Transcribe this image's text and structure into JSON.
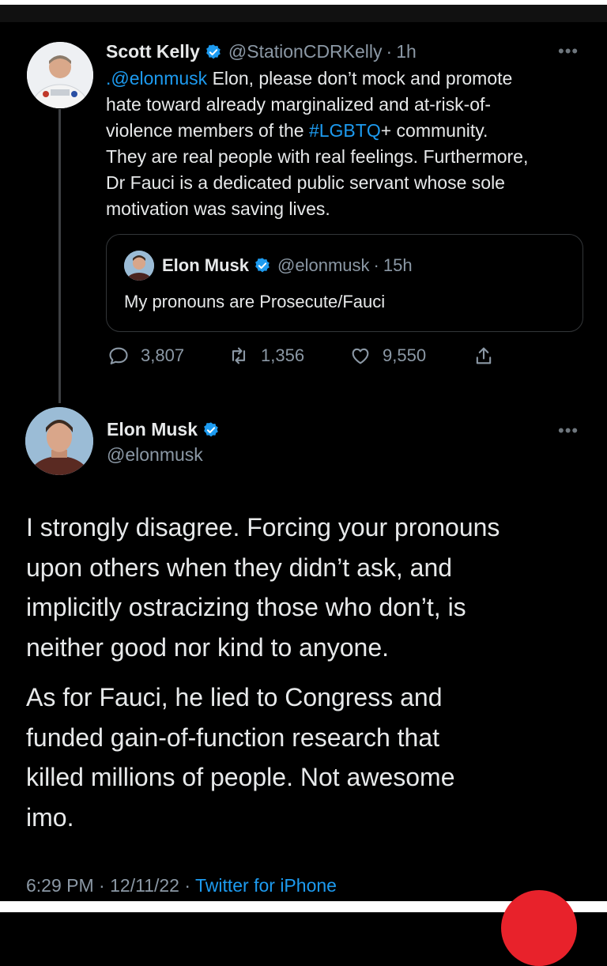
{
  "parent_tweet": {
    "author_name": "Scott Kelly",
    "handle": "@StationCDRKelly",
    "separator": "·",
    "time": "1h",
    "more": "•••",
    "text_lines": [
      {
        "mention": ".@elonmusk",
        "rest": " Elon, please don’t mock and promote"
      },
      {
        "plain": "hate toward already marginalized and at-risk-of-"
      },
      {
        "before": "violence members of the ",
        "hashtag": "#LGBTQ",
        "after": "+ community."
      },
      {
        "plain": "They are real people with real feelings. Furthermore,"
      },
      {
        "plain": "Dr Fauci is a dedicated public servant whose sole"
      },
      {
        "plain": "motivation was saving lives."
      }
    ],
    "quote": {
      "author_name": "Elon Musk",
      "handle": "@elonmusk",
      "separator": "·",
      "time": "15h",
      "text": "My pronouns are Prosecute/Fauci"
    },
    "actions": {
      "replies": "3,807",
      "retweets": "1,356",
      "likes": "9,550"
    }
  },
  "main_tweet": {
    "author_name": "Elon Musk",
    "handle": "@elonmusk",
    "more": "•••",
    "paragraph1_lines": [
      "I strongly disagree. Forcing your pronouns",
      "upon others when they didn’t ask, and",
      "implicitly ostracizing those who don’t, is",
      "neither good nor kind to anyone."
    ],
    "paragraph2_lines": [
      "As for Fauci, he lied to Congress and",
      "funded gain-of-function research that",
      "killed millions of people. Not awesome",
      "imo."
    ],
    "footer": {
      "time": "6:29 PM",
      "separator1": " · ",
      "date": "12/11/22",
      "separator2": " · ",
      "source": "Twitter for iPhone"
    }
  },
  "colors": {
    "background": "#000000",
    "text": "#e7e9ea",
    "secondary": "#8b98a5",
    "link": "#1d9bf0",
    "verified": "#1d9bf0"
  }
}
